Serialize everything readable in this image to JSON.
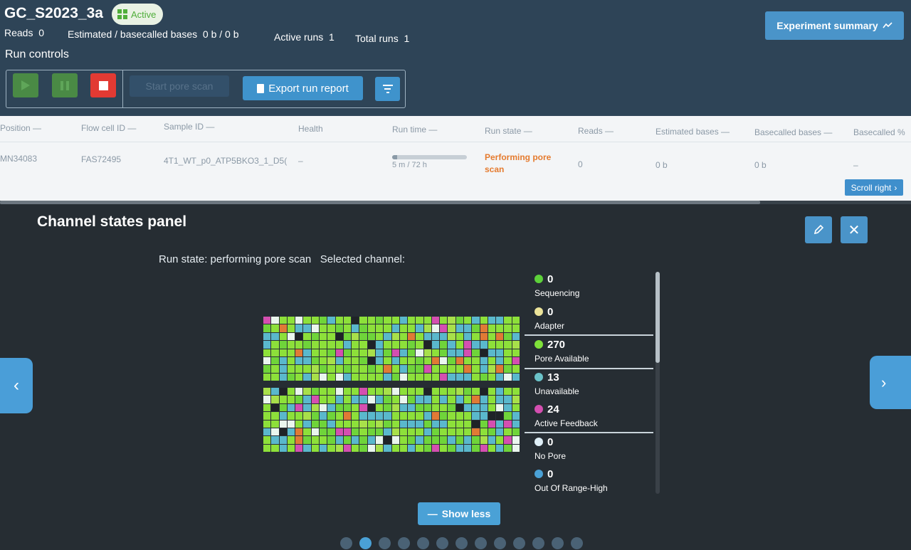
{
  "header": {
    "experiment_name": "GC_S2023_3a",
    "status_badge": "Active",
    "stats": [
      {
        "label": "Reads",
        "value": "0"
      },
      {
        "label": "Estimated / basecalled bases",
        "value": "0 b / 0 b"
      },
      {
        "label": "Active runs",
        "value": "1"
      },
      {
        "label": "Total runs",
        "value": "1"
      }
    ],
    "experiment_summary_label": "Experiment summary"
  },
  "run_controls": {
    "title": "Run controls",
    "start_pore_scan_label": "Start pore scan",
    "export_run_report_label": "Export run report"
  },
  "table": {
    "columns": [
      "Position",
      "Flow cell ID",
      "Sample ID",
      "Health",
      "Run time",
      "Run state",
      "Reads",
      "Estimated bases",
      "Basecalled bases",
      "Basecalled %"
    ],
    "row": {
      "position": "MN34083",
      "flow_cell_id": "FAS72495",
      "sample_id": "4T1_WT_p0_ATP5BKO3_1_D5(",
      "health": "–",
      "run_time": "5 m / 72 h",
      "run_time_progress": 0.07,
      "run_state": "Performing pore scan",
      "reads": "0",
      "estimated_bases": "0 b",
      "basecalled_bases": "0 b",
      "basecalled_percent": "–"
    },
    "scroll_right_label": "Scroll right"
  },
  "channel_panel": {
    "title": "Channel states panel",
    "run_state_text": "Run state: performing pore scan",
    "selected_channel_text": "Selected channel:",
    "show_less_label": "Show less",
    "legend": [
      {
        "count": "0",
        "label": "Sequencing",
        "color": "#5dd13a"
      },
      {
        "count": "0",
        "label": "Adapter",
        "color": "#ece49a"
      },
      {
        "count": "270",
        "label": "Pore Available",
        "color": "#7fe13a"
      },
      {
        "count": "13",
        "label": "Unavailable",
        "color": "#6bc3c9"
      },
      {
        "count": "24",
        "label": "Active Feedback",
        "color": "#d44fb0"
      },
      {
        "count": "0",
        "label": "No Pore",
        "color": "#dfeff7"
      },
      {
        "count": "0",
        "label": "Out Of Range-High",
        "color": "#4aa1d6"
      }
    ],
    "grid_colors": [
      "#8de03a",
      "#6fd43a",
      "#5ab8cc",
      "#d44fb0",
      "#eaf6ee",
      "#1f2327",
      "#e07a35",
      "#a8e04a"
    ],
    "page_count": 13,
    "active_page": 1
  }
}
